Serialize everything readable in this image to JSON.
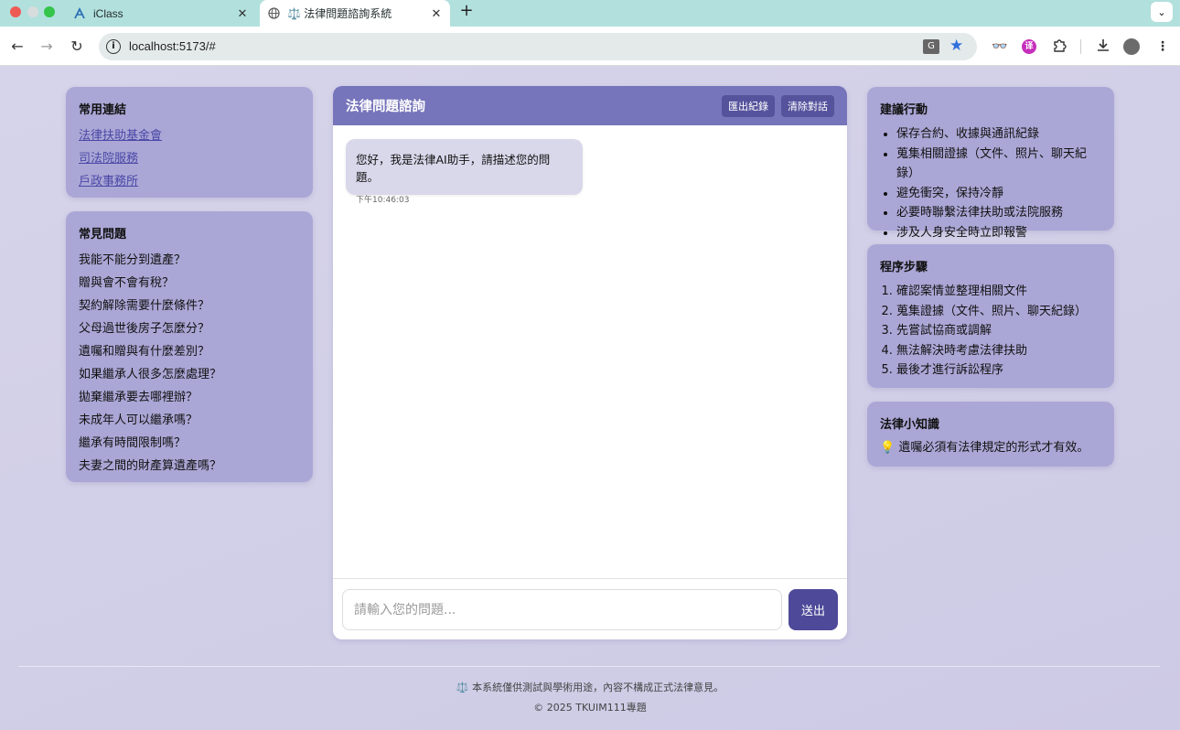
{
  "browser": {
    "tabs": [
      {
        "title": "iClass",
        "icon": "iclass-logo-icon"
      },
      {
        "title": "⚖️ 法律問題諮詢系統",
        "icon": "globe-icon"
      }
    ],
    "url": "localhost:5173/#"
  },
  "sidebar_left": {
    "links_title": "常用連結",
    "links": [
      "法律扶助基金會",
      "司法院服務",
      "戶政事務所"
    ],
    "faq_title": "常見問題",
    "faq": [
      "我能不能分到遺產？",
      "贈與會不會有稅？",
      "契約解除需要什麼條件？",
      "父母過世後房子怎麼分？",
      "遺囑和贈與有什麼差別？",
      "如果繼承人很多怎麼處理？",
      "拋棄繼承要去哪裡辦？",
      "未成年人可以繼承嗎？",
      "繼承有時間限制嗎？",
      "夫妻之間的財產算遺產嗎？"
    ]
  },
  "chat": {
    "title": "法律問題諮詢",
    "export_label": "匯出紀錄",
    "clear_label": "清除對話",
    "messages": [
      {
        "text": "您好，我是法律AI助手，請描述您的問題。",
        "time": "下午10:46:03"
      }
    ],
    "input_placeholder": "請輸入您的問題...",
    "send_label": "送出"
  },
  "sidebar_right": {
    "actions_title": "建議行動",
    "actions": [
      "保存合約、收據與通訊紀錄",
      "蒐集相關證據（文件、照片、聊天紀錄）",
      "避免衝突，保持冷靜",
      "必要時聯繫法律扶助或法院服務",
      "涉及人身安全時立即報警"
    ],
    "steps_title": "程序步驟",
    "steps": [
      "確認案情並整理相關文件",
      "蒐集證據（文件、照片、聊天紀錄）",
      "先嘗試協商或調解",
      "無法解決時考慮法律扶助",
      "最後才進行訴訟程序"
    ],
    "tip_title": "法律小知識",
    "tip": "💡 遺囑必須有法律規定的形式才有效。"
  },
  "footer": {
    "note": "⚖️ 本系統僅供測試與學術用途，內容不構成正式法律意見。",
    "copyright": "© 2025 TKUIM111專題"
  }
}
